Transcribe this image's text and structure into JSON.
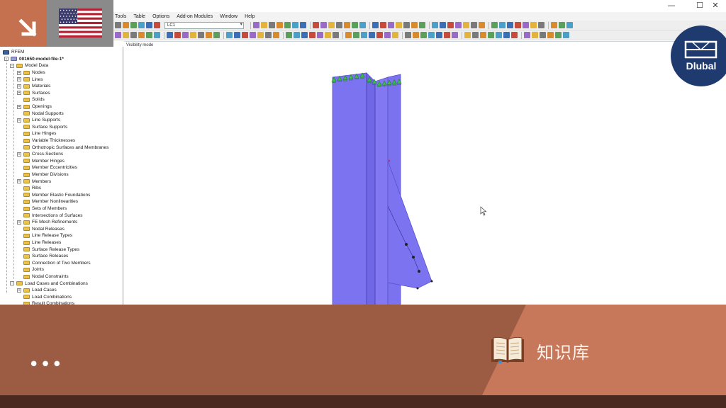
{
  "window": {
    "minimize": "—",
    "maximize": "☐",
    "close": "✕"
  },
  "menubar": {
    "items": [
      "Tools",
      "Table",
      "Options",
      "Add-on Modules",
      "Window",
      "Help"
    ]
  },
  "toolbar": {
    "load_case": "LC1"
  },
  "navigator": {
    "header": "RFEM",
    "file": "001650-model-file-1*",
    "items": [
      {
        "label": "Model Data",
        "level": 1,
        "toggle": "-"
      },
      {
        "label": "Nodes",
        "level": 2,
        "toggle": "+"
      },
      {
        "label": "Lines",
        "level": 2,
        "toggle": "+"
      },
      {
        "label": "Materials",
        "level": 2,
        "toggle": "+"
      },
      {
        "label": "Surfaces",
        "level": 2,
        "toggle": "+"
      },
      {
        "label": "Solids",
        "level": 2,
        "toggle": ""
      },
      {
        "label": "Openings",
        "level": 2,
        "toggle": "+"
      },
      {
        "label": "Nodal Supports",
        "level": 2,
        "toggle": ""
      },
      {
        "label": "Line Supports",
        "level": 2,
        "toggle": "+"
      },
      {
        "label": "Surface Supports",
        "level": 2,
        "toggle": ""
      },
      {
        "label": "Line Hinges",
        "level": 2,
        "toggle": ""
      },
      {
        "label": "Variable Thicknesses",
        "level": 2,
        "toggle": ""
      },
      {
        "label": "Orthotropic Surfaces and Membranes",
        "level": 2,
        "toggle": ""
      },
      {
        "label": "Cross-Sections",
        "level": 2,
        "toggle": "+"
      },
      {
        "label": "Member Hinges",
        "level": 2,
        "toggle": ""
      },
      {
        "label": "Member Eccentricities",
        "level": 2,
        "toggle": ""
      },
      {
        "label": "Member Divisions",
        "level": 2,
        "toggle": ""
      },
      {
        "label": "Members",
        "level": 2,
        "toggle": "+"
      },
      {
        "label": "Ribs",
        "level": 2,
        "toggle": ""
      },
      {
        "label": "Member Elastic Foundations",
        "level": 2,
        "toggle": ""
      },
      {
        "label": "Member Nonlinearities",
        "level": 2,
        "toggle": ""
      },
      {
        "label": "Sets of Members",
        "level": 2,
        "toggle": ""
      },
      {
        "label": "Intersections of Surfaces",
        "level": 2,
        "toggle": ""
      },
      {
        "label": "FE Mesh Refinements",
        "level": 2,
        "toggle": "+"
      },
      {
        "label": "Nodal Releases",
        "level": 2,
        "toggle": ""
      },
      {
        "label": "Line Release Types",
        "level": 2,
        "toggle": ""
      },
      {
        "label": "Line Releases",
        "level": 2,
        "toggle": ""
      },
      {
        "label": "Surface Release Types",
        "level": 2,
        "toggle": ""
      },
      {
        "label": "Surface Releases",
        "level": 2,
        "toggle": ""
      },
      {
        "label": "Connection of Two Members",
        "level": 2,
        "toggle": ""
      },
      {
        "label": "Joints",
        "level": 2,
        "toggle": ""
      },
      {
        "label": "Nodal Constraints",
        "level": 2,
        "toggle": ""
      },
      {
        "label": "Load Cases and Combinations",
        "level": 1,
        "toggle": "-"
      },
      {
        "label": "Load Cases",
        "level": 2,
        "toggle": "+"
      },
      {
        "label": "Load Combinations",
        "level": 2,
        "toggle": ""
      },
      {
        "label": "Result Combinations",
        "level": 2,
        "toggle": ""
      }
    ]
  },
  "viewport": {
    "mode_label": "Visibility mode"
  },
  "branding": {
    "logo_text": "Dlubal"
  },
  "banner": {
    "title": "知识库",
    "more": "•••"
  },
  "colors": {
    "orange": "#c5704f",
    "banner_dark": "#9c5c44",
    "banner_light": "#c8785a",
    "banner_strip": "#4a2a20",
    "member_blue": "#7b73f0",
    "dlubal_navy": "#1f3a6e",
    "support_green": "#3fbf4a"
  }
}
